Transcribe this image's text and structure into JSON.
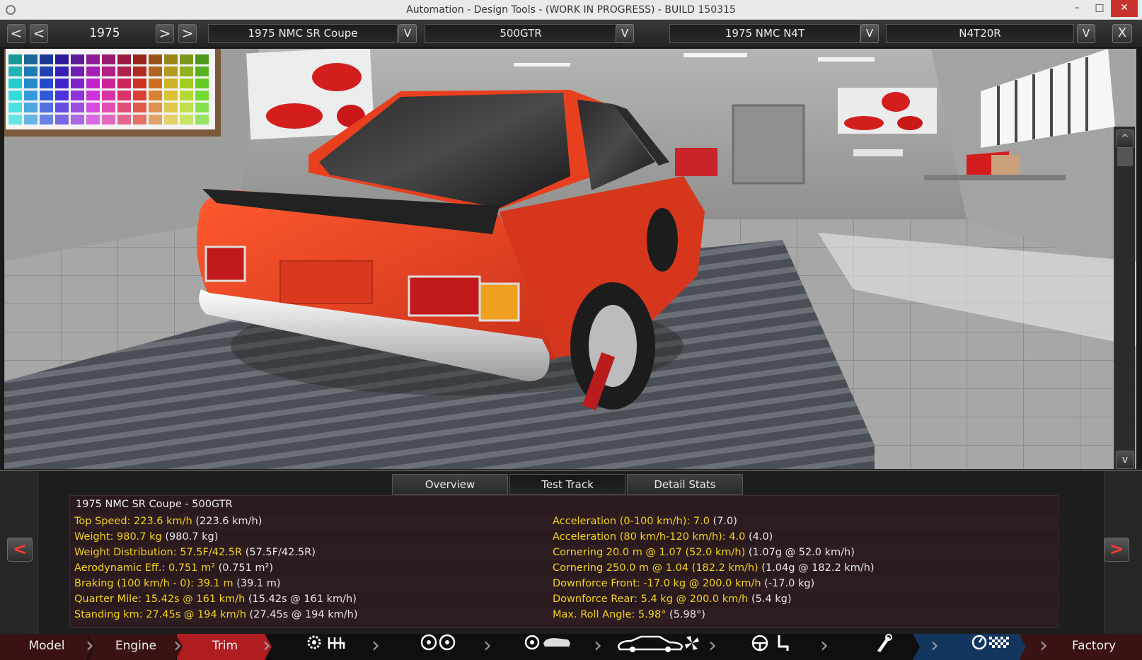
{
  "window": {
    "title": "Automation - Design Tools - (WORK IN PROGRESS) - BUILD 150315",
    "min_label": "–",
    "max_label": "□",
    "close_label": "✕"
  },
  "topbar": {
    "prev_label": "<",
    "next_label": ">",
    "year": "1975",
    "model_select": "1975 NMC SR Coupe",
    "trim_select": "500GTR",
    "engine_family_select": "1975 NMC N4T",
    "engine_variant_select": "N4T20R",
    "dropdown_glyph": "V",
    "close_glyph": "X"
  },
  "viewport": {
    "car_color": "#e8401f",
    "scroll_up": "^",
    "scroll_down": "v"
  },
  "panel": {
    "tabs": [
      "Overview",
      "Test Track",
      "Detail Stats"
    ],
    "active_tab": "Test Track",
    "title": "1975 NMC SR Coupe - 500GTR",
    "left_stats": [
      {
        "k": "Top Speed: 223.6 km/h",
        "v": "(223.6 km/h)"
      },
      {
        "k": "Weight: 980.7 kg",
        "v": "(980.7 kg)"
      },
      {
        "k": "Weight Distribution: 57.5F/42.5R",
        "v": "(57.5F/42.5R)"
      },
      {
        "k": "Aerodynamic Eff.: 0.751 m²",
        "v": "(0.751 m²)"
      },
      {
        "k": "Braking (100 km/h - 0): 39.1 m",
        "v": "(39.1 m)"
      },
      {
        "k": "Quarter Mile: 15.42s @ 161 km/h",
        "v": "(15.42s @ 161 km/h)"
      },
      {
        "k": "Standing km: 27.45s @ 194 km/h",
        "v": "(27.45s @ 194 km/h)"
      }
    ],
    "right_stats": [
      {
        "k": "Acceleration (0-100 km/h): 7.0",
        "v": "(7.0)"
      },
      {
        "k": "Acceleration (80 km/h-120 km/h): 4.0",
        "v": "(4.0)"
      },
      {
        "k": "Cornering 20.0 m @ 1.07 (52.0 km/h)",
        "v": "(1.07g @ 52.0 km/h)"
      },
      {
        "k": "Cornering 250.0 m @ 1.04 (182.2 km/h)",
        "v": "(1.04g @ 182.2 km/h)"
      },
      {
        "k": "Downforce Front: -17.0 kg @ 200.0 km/h",
        "v": "(-17.0 kg)"
      },
      {
        "k": "Downforce Rear: 5.4 kg @ 200.0 km/h",
        "v": "(5.4 kg)"
      },
      {
        "k": "Max. Roll Angle: 5.98°",
        "v": "(5.98°)"
      }
    ],
    "prev_arrow": "<",
    "next_arrow": ">"
  },
  "bottomnav": {
    "model": "Model",
    "engine": "Engine",
    "trim": "Trim",
    "factory": "Factory",
    "active": "Trim",
    "accent": "#c0262b"
  }
}
